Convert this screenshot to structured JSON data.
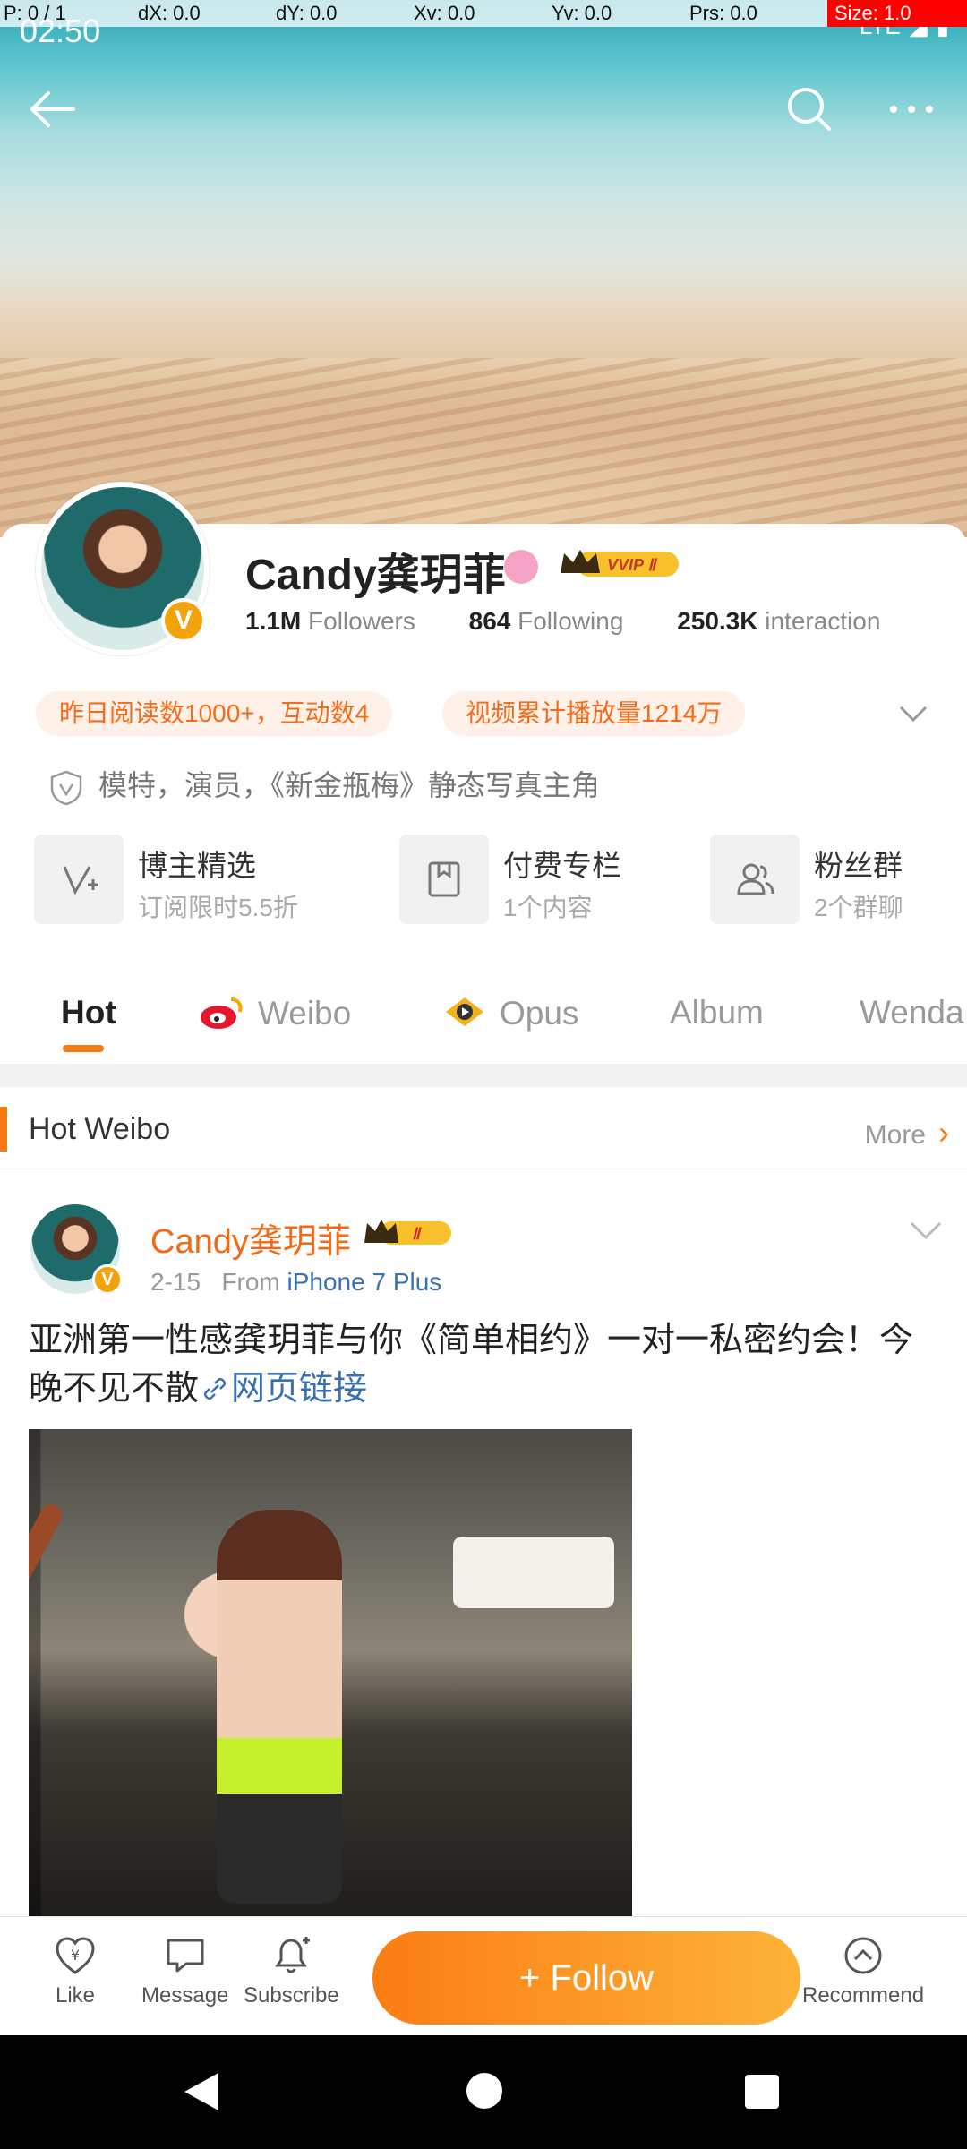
{
  "debug": {
    "p": "P: 0 / 1",
    "dx": "dX: 0.0",
    "dy": "dY: 0.0",
    "xv": "Xv: 0.0",
    "yv": "Yv: 0.0",
    "prs": "Prs: 0.0",
    "size": "Size: 1.0"
  },
  "status": {
    "time": "02:50",
    "network": "LTE"
  },
  "profile": {
    "name": "Candy龚玥菲",
    "vip_label": "VVIP Ⅱ",
    "verified_mark": "V",
    "followers_count": "1.1M",
    "followers_label": "Followers",
    "following_count": "864",
    "following_label": "Following",
    "interaction_count": "250.3K",
    "interaction_label": "interaction",
    "chips": [
      "昨日阅读数1000+，互动数4",
      "视频累计播放量1214万"
    ],
    "bio": "模特，演员，《新金瓶梅》静态写真主角"
  },
  "features": [
    {
      "title": "博主精选",
      "subtitle": "订阅限时5.5折"
    },
    {
      "title": "付费专栏",
      "subtitle": "1个内容"
    },
    {
      "title": "粉丝群",
      "subtitle": "2个群聊"
    }
  ],
  "tabs": [
    "Hot",
    "Weibo",
    "Opus",
    "Album",
    "Wenda"
  ],
  "section": {
    "title": "Hot Weibo",
    "more": "More"
  },
  "post": {
    "author": "Candy龚玥菲",
    "vip_label": "Ⅱ",
    "date": "2-15",
    "from_label": "From",
    "source": "iPhone 7 Plus",
    "text": "亚洲第一性感龚玥菲与你《简单相约》一对一私密约会！今晚不见不散",
    "link_text": "网页链接"
  },
  "bottom_bar": {
    "like": "Like",
    "message": "Message",
    "subscribe": "Subscribe",
    "follow": "+ Follow",
    "recommend": "Recommend"
  },
  "colors": {
    "accent": "#f57a14",
    "link": "#3a6fb0",
    "chip_bg": "#fff1e8"
  }
}
